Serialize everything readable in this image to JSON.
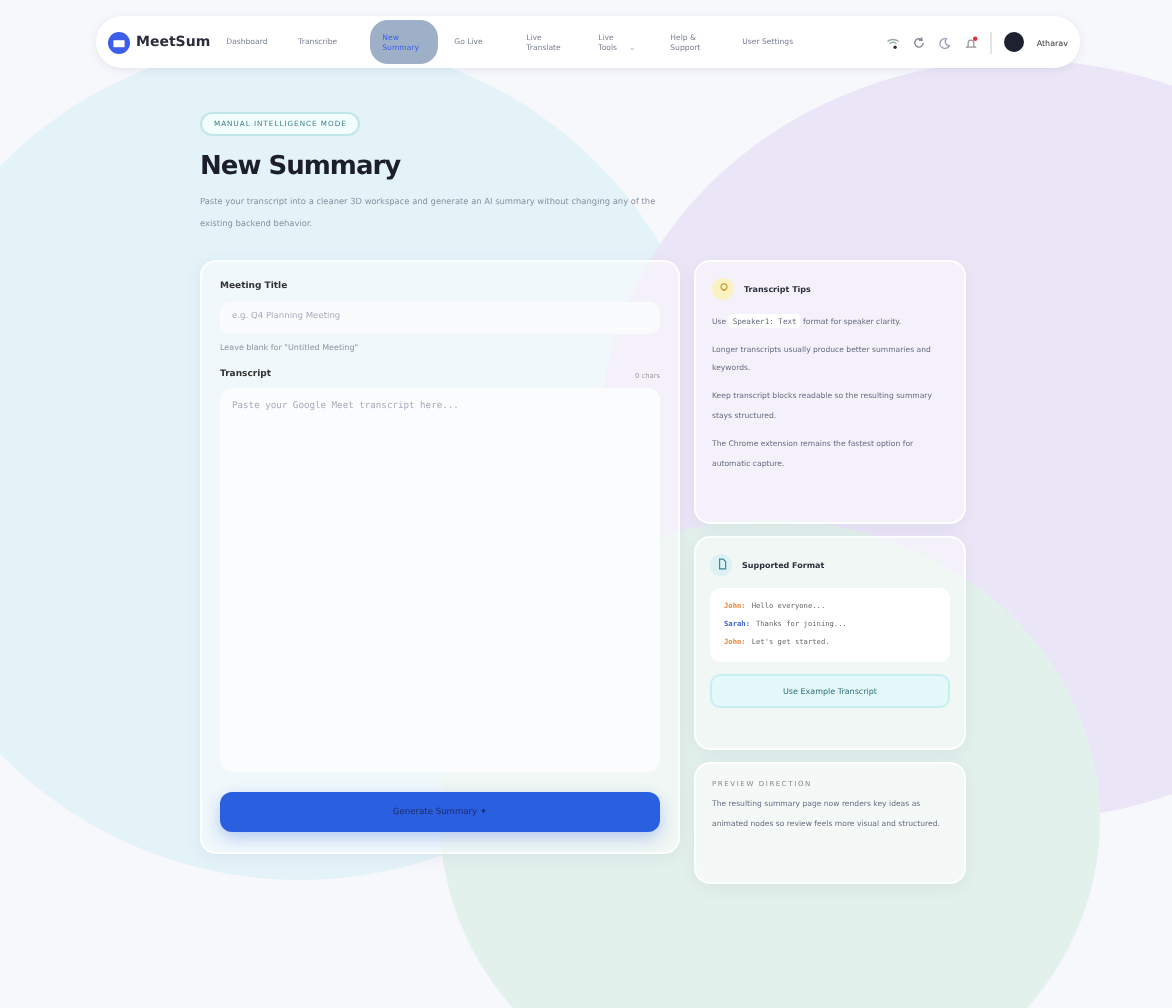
{
  "nav": {
    "brand": "MeetSum",
    "items": [
      {
        "label": "Dashboard",
        "selected": false
      },
      {
        "label": "Transcribe",
        "selected": false
      },
      {
        "label": "New Summary",
        "selected": true
      },
      {
        "label": "Go Live",
        "selected": false
      },
      {
        "label": "Live Translate",
        "selected": false
      },
      {
        "label": "Live Tools",
        "selected": false,
        "caret": "⌄"
      },
      {
        "label": "Help & Support",
        "selected": false
      },
      {
        "label": "User Settings",
        "selected": false
      }
    ],
    "notification": true,
    "user": "Atharav"
  },
  "badge": "MANUAL INTELLIGENCE MODE",
  "title": "New Summary",
  "description": "Paste your transcript into a cleaner 3D workspace and generate an AI summary without changing any of the existing backend behavior.",
  "form": {
    "title_label": "Meeting Title",
    "title_placeholder": "e.g. Q4 Planning Meeting",
    "title_hint": "Leave blank for \"Untitled Meeting\"",
    "transcript_label": "Transcript",
    "char_count": "0 chars",
    "transcript_placeholder": "Paste your Google Meet transcript here...",
    "button": "Generate Summary",
    "button_icon": "✦"
  },
  "tips": {
    "title": "Transcript Tips",
    "items": [
      {
        "kind": "code",
        "before": "Use",
        "code": "Speaker1: Text",
        "after": "format for speaker clarity."
      },
      {
        "kind": "text",
        "text": "Longer transcripts usually produce better summaries and keywords."
      },
      {
        "kind": "text",
        "text": "Keep transcript blocks readable so the resulting summary stays structured."
      },
      {
        "kind": "text",
        "text": "The Chrome extension remains the fastest option for automatic capture."
      }
    ]
  },
  "format": {
    "title": "Supported Format",
    "lines": [
      {
        "speaker": "John:",
        "text": "Hello everyone...",
        "color": "#e8823a"
      },
      {
        "speaker": "Sarah:",
        "text": "Thanks for joining...",
        "color": "#3d63c9"
      },
      {
        "speaker": "John:",
        "text": "Let's get started.",
        "color": "#e8823a"
      }
    ],
    "button": "Use Example Transcript"
  },
  "preview": {
    "heading": "PREVIEW DIRECTION",
    "text": "The resulting summary page now renders key ideas as animated nodes so review feels more visual and structured."
  }
}
